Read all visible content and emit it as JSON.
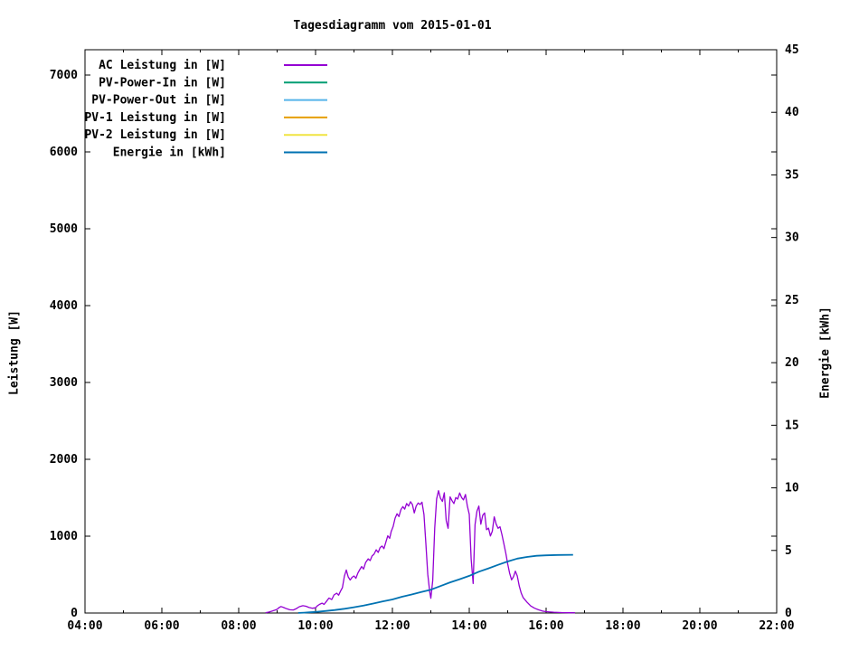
{
  "title": "Tagesdiagramm vom 2015-01-01",
  "axes": {
    "y1_label": "Leistung [W]",
    "y2_label": "Energie [kWh]"
  },
  "legend": [
    {
      "label": "AC Leistung in [W]",
      "color": "#9400d3"
    },
    {
      "label": "PV-Power-In in [W]",
      "color": "#009e73"
    },
    {
      "label": "PV-Power-Out in [W]",
      "color": "#56b4e9"
    },
    {
      "label": "PV-1 Leistung in [W]",
      "color": "#e69f00"
    },
    {
      "label": "PV-2 Leistung in [W]",
      "color": "#f0e442"
    },
    {
      "label": "Energie in [kWh]",
      "color": "#0072b2"
    }
  ],
  "chart_data": {
    "type": "line",
    "title": "Tagesdiagramm vom 2015-01-01",
    "xlabel": "",
    "ylabel": "Leistung [W]",
    "y2label": "Energie [kWh]",
    "grid": false,
    "legend_position": "top-left-inside",
    "x_unit": "hour-of-day",
    "x_range": [
      4,
      22
    ],
    "x_major_ticks": [
      4,
      6,
      8,
      10,
      12,
      14,
      16,
      18,
      20,
      22
    ],
    "x_tick_labels": [
      "04:00",
      "06:00",
      "08:00",
      "10:00",
      "12:00",
      "14:00",
      "16:00",
      "18:00",
      "20:00",
      "22:00"
    ],
    "x_minor_step_hours": 1,
    "y1": {
      "label": "Leistung [W]",
      "range": [
        0,
        7330
      ],
      "ticks": [
        0,
        1000,
        2000,
        3000,
        4000,
        5000,
        6000,
        7000
      ]
    },
    "y2": {
      "label": "Energie [kWh]",
      "range": [
        0,
        45
      ],
      "ticks": [
        0,
        5,
        10,
        15,
        20,
        25,
        30,
        35,
        40,
        45
      ]
    },
    "series": [
      {
        "name": "AC Leistung in [W]",
        "color": "#9400d3",
        "axis": "y1",
        "width": 1.3,
        "points": [
          [
            8.7,
            5
          ],
          [
            8.78,
            12
          ],
          [
            8.85,
            22
          ],
          [
            8.93,
            35
          ],
          [
            9.0,
            48
          ],
          [
            9.05,
            70
          ],
          [
            9.1,
            85
          ],
          [
            9.17,
            72
          ],
          [
            9.25,
            55
          ],
          [
            9.33,
            42
          ],
          [
            9.42,
            40
          ],
          [
            9.5,
            58
          ],
          [
            9.58,
            82
          ],
          [
            9.67,
            95
          ],
          [
            9.75,
            88
          ],
          [
            9.83,
            72
          ],
          [
            9.92,
            62
          ],
          [
            10.0,
            68
          ],
          [
            10.05,
            95
          ],
          [
            10.1,
            112
          ],
          [
            10.17,
            128
          ],
          [
            10.22,
            112
          ],
          [
            10.28,
            150
          ],
          [
            10.35,
            195
          ],
          [
            10.42,
            175
          ],
          [
            10.48,
            235
          ],
          [
            10.55,
            258
          ],
          [
            10.6,
            232
          ],
          [
            10.65,
            285
          ],
          [
            10.7,
            330
          ],
          [
            10.75,
            480
          ],
          [
            10.8,
            560
          ],
          [
            10.85,
            470
          ],
          [
            10.9,
            430
          ],
          [
            10.95,
            465
          ],
          [
            11.0,
            482
          ],
          [
            11.05,
            452
          ],
          [
            11.1,
            520
          ],
          [
            11.15,
            565
          ],
          [
            11.2,
            605
          ],
          [
            11.25,
            572
          ],
          [
            11.3,
            655
          ],
          [
            11.37,
            705
          ],
          [
            11.42,
            682
          ],
          [
            11.47,
            742
          ],
          [
            11.52,
            765
          ],
          [
            11.58,
            822
          ],
          [
            11.63,
            788
          ],
          [
            11.68,
            852
          ],
          [
            11.73,
            872
          ],
          [
            11.78,
            838
          ],
          [
            11.83,
            925
          ],
          [
            11.88,
            1005
          ],
          [
            11.93,
            972
          ],
          [
            11.97,
            1062
          ],
          [
            12.02,
            1125
          ],
          [
            12.07,
            1235
          ],
          [
            12.12,
            1292
          ],
          [
            12.17,
            1255
          ],
          [
            12.22,
            1345
          ],
          [
            12.27,
            1385
          ],
          [
            12.32,
            1352
          ],
          [
            12.37,
            1425
          ],
          [
            12.42,
            1392
          ],
          [
            12.47,
            1448
          ],
          [
            12.52,
            1412
          ],
          [
            12.57,
            1302
          ],
          [
            12.62,
            1392
          ],
          [
            12.67,
            1432
          ],
          [
            12.72,
            1412
          ],
          [
            12.77,
            1442
          ],
          [
            12.82,
            1282
          ],
          [
            12.87,
            905
          ],
          [
            12.92,
            505
          ],
          [
            12.97,
            282
          ],
          [
            13.0,
            192
          ],
          [
            13.05,
            425
          ],
          [
            13.1,
            1105
          ],
          [
            13.15,
            1485
          ],
          [
            13.2,
            1592
          ],
          [
            13.25,
            1495
          ],
          [
            13.3,
            1452
          ],
          [
            13.35,
            1565
          ],
          [
            13.4,
            1205
          ],
          [
            13.45,
            1102
          ],
          [
            13.5,
            1512
          ],
          [
            13.55,
            1462
          ],
          [
            13.6,
            1425
          ],
          [
            13.65,
            1502
          ],
          [
            13.7,
            1482
          ],
          [
            13.75,
            1562
          ],
          [
            13.8,
            1502
          ],
          [
            13.85,
            1472
          ],
          [
            13.9,
            1542
          ],
          [
            13.95,
            1392
          ],
          [
            14.0,
            1285
          ],
          [
            14.05,
            702
          ],
          [
            14.1,
            385
          ],
          [
            14.15,
            1152
          ],
          [
            14.2,
            1325
          ],
          [
            14.25,
            1392
          ],
          [
            14.3,
            1155
          ],
          [
            14.35,
            1272
          ],
          [
            14.4,
            1302
          ],
          [
            14.45,
            1085
          ],
          [
            14.5,
            1105
          ],
          [
            14.55,
            1002
          ],
          [
            14.6,
            1065
          ],
          [
            14.65,
            1252
          ],
          [
            14.7,
            1155
          ],
          [
            14.75,
            1102
          ],
          [
            14.8,
            1122
          ],
          [
            14.85,
            1022
          ],
          [
            14.9,
            900
          ],
          [
            14.95,
            780
          ],
          [
            15.0,
            640
          ],
          [
            15.05,
            520
          ],
          [
            15.1,
            432
          ],
          [
            15.15,
            472
          ],
          [
            15.2,
            545
          ],
          [
            15.25,
            482
          ],
          [
            15.3,
            352
          ],
          [
            15.35,
            262
          ],
          [
            15.4,
            202
          ],
          [
            15.5,
            142
          ],
          [
            15.6,
            92
          ],
          [
            15.7,
            62
          ],
          [
            15.8,
            42
          ],
          [
            15.9,
            26
          ],
          [
            16.0,
            18
          ],
          [
            16.2,
            10
          ],
          [
            16.4,
            6
          ],
          [
            16.6,
            4
          ],
          [
            16.75,
            3
          ]
        ]
      },
      {
        "name": "PV-Power-In in [W]",
        "color": "#009e73",
        "axis": "y1",
        "width": 1.3,
        "points": []
      },
      {
        "name": "PV-Power-Out in [W]",
        "color": "#56b4e9",
        "axis": "y1",
        "width": 1.3,
        "points": []
      },
      {
        "name": "PV-1 Leistung in [W]",
        "color": "#e69f00",
        "axis": "y1",
        "width": 1.3,
        "points": []
      },
      {
        "name": "PV-2 Leistung in [W]",
        "color": "#f0e442",
        "axis": "y1",
        "width": 1.3,
        "points": []
      },
      {
        "name": "Energie in [kWh]",
        "color": "#0072b2",
        "axis": "y2",
        "width": 1.8,
        "points": [
          [
            9.55,
            0.01
          ],
          [
            9.7,
            0.03
          ],
          [
            9.85,
            0.06
          ],
          [
            10.0,
            0.09
          ],
          [
            10.25,
            0.16
          ],
          [
            10.5,
            0.24
          ],
          [
            10.75,
            0.34
          ],
          [
            11.0,
            0.46
          ],
          [
            11.25,
            0.6
          ],
          [
            11.5,
            0.76
          ],
          [
            11.75,
            0.93
          ],
          [
            12.0,
            1.08
          ],
          [
            12.25,
            1.3
          ],
          [
            12.5,
            1.48
          ],
          [
            12.75,
            1.68
          ],
          [
            13.0,
            1.86
          ],
          [
            13.25,
            2.15
          ],
          [
            13.5,
            2.45
          ],
          [
            13.75,
            2.7
          ],
          [
            14.0,
            2.97
          ],
          [
            14.25,
            3.3
          ],
          [
            14.5,
            3.57
          ],
          [
            14.75,
            3.85
          ],
          [
            15.0,
            4.12
          ],
          [
            15.25,
            4.35
          ],
          [
            15.5,
            4.48
          ],
          [
            15.75,
            4.57
          ],
          [
            16.0,
            4.61
          ],
          [
            16.3,
            4.64
          ],
          [
            16.7,
            4.65
          ]
        ]
      }
    ]
  }
}
